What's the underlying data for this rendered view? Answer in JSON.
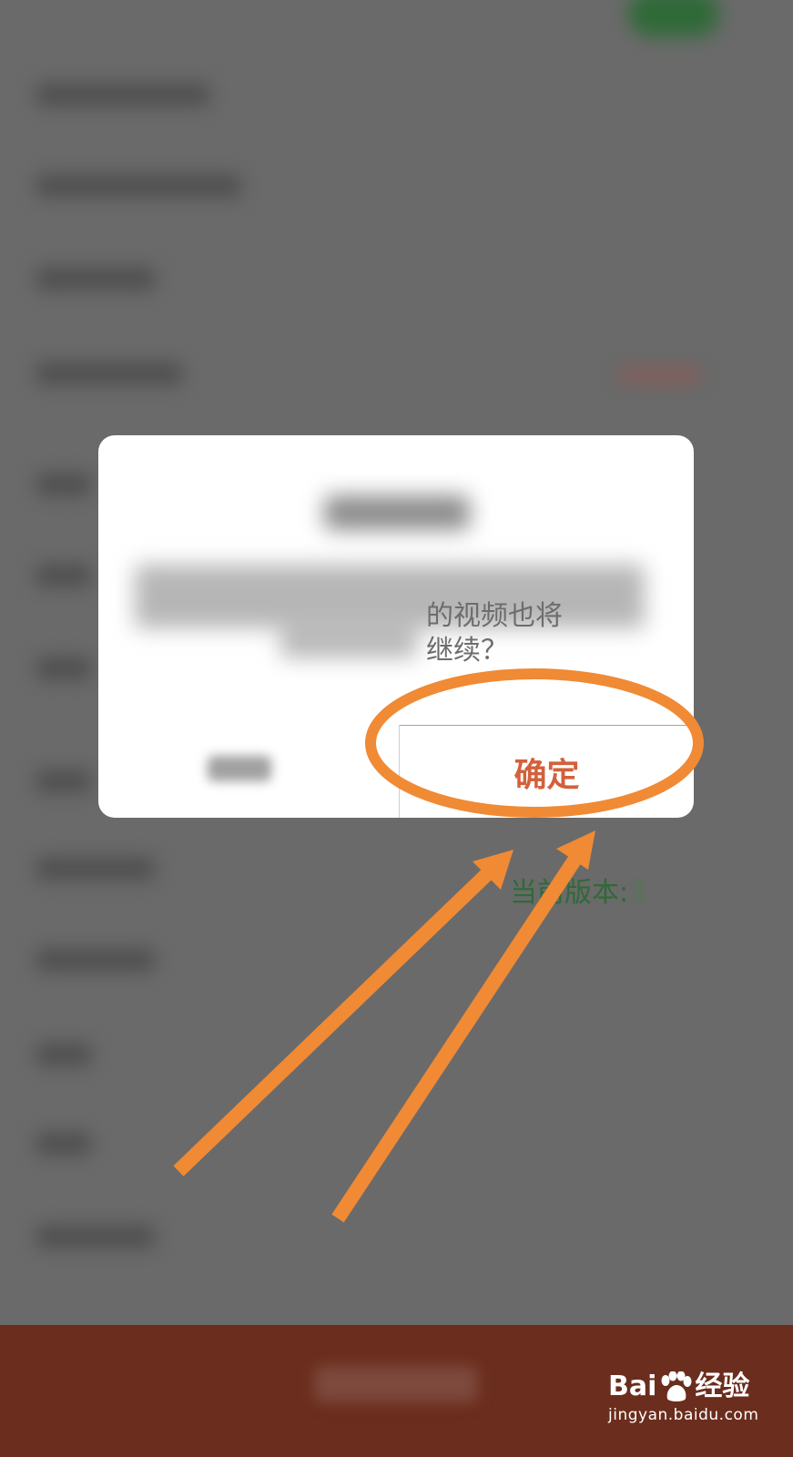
{
  "dialog": {
    "message_line1": "的视频也将",
    "message_line2": "继续？",
    "confirm_label": "确定"
  },
  "version": {
    "prefix": "当前版本:",
    "suffix": "3"
  },
  "watermark": {
    "brand_left": "Bai",
    "brand_right": "经验",
    "url": "jingyan.baidu.com"
  },
  "colors": {
    "accent_orange": "#f08a35",
    "confirm_text": "#d3603a",
    "bottom_bar": "#6b2d1d",
    "version_green": "#2f6a38",
    "overlay_gray": "#6a6a6a"
  },
  "icons": [
    "paw-icon",
    "annotation-arrow",
    "highlight-ellipse"
  ]
}
